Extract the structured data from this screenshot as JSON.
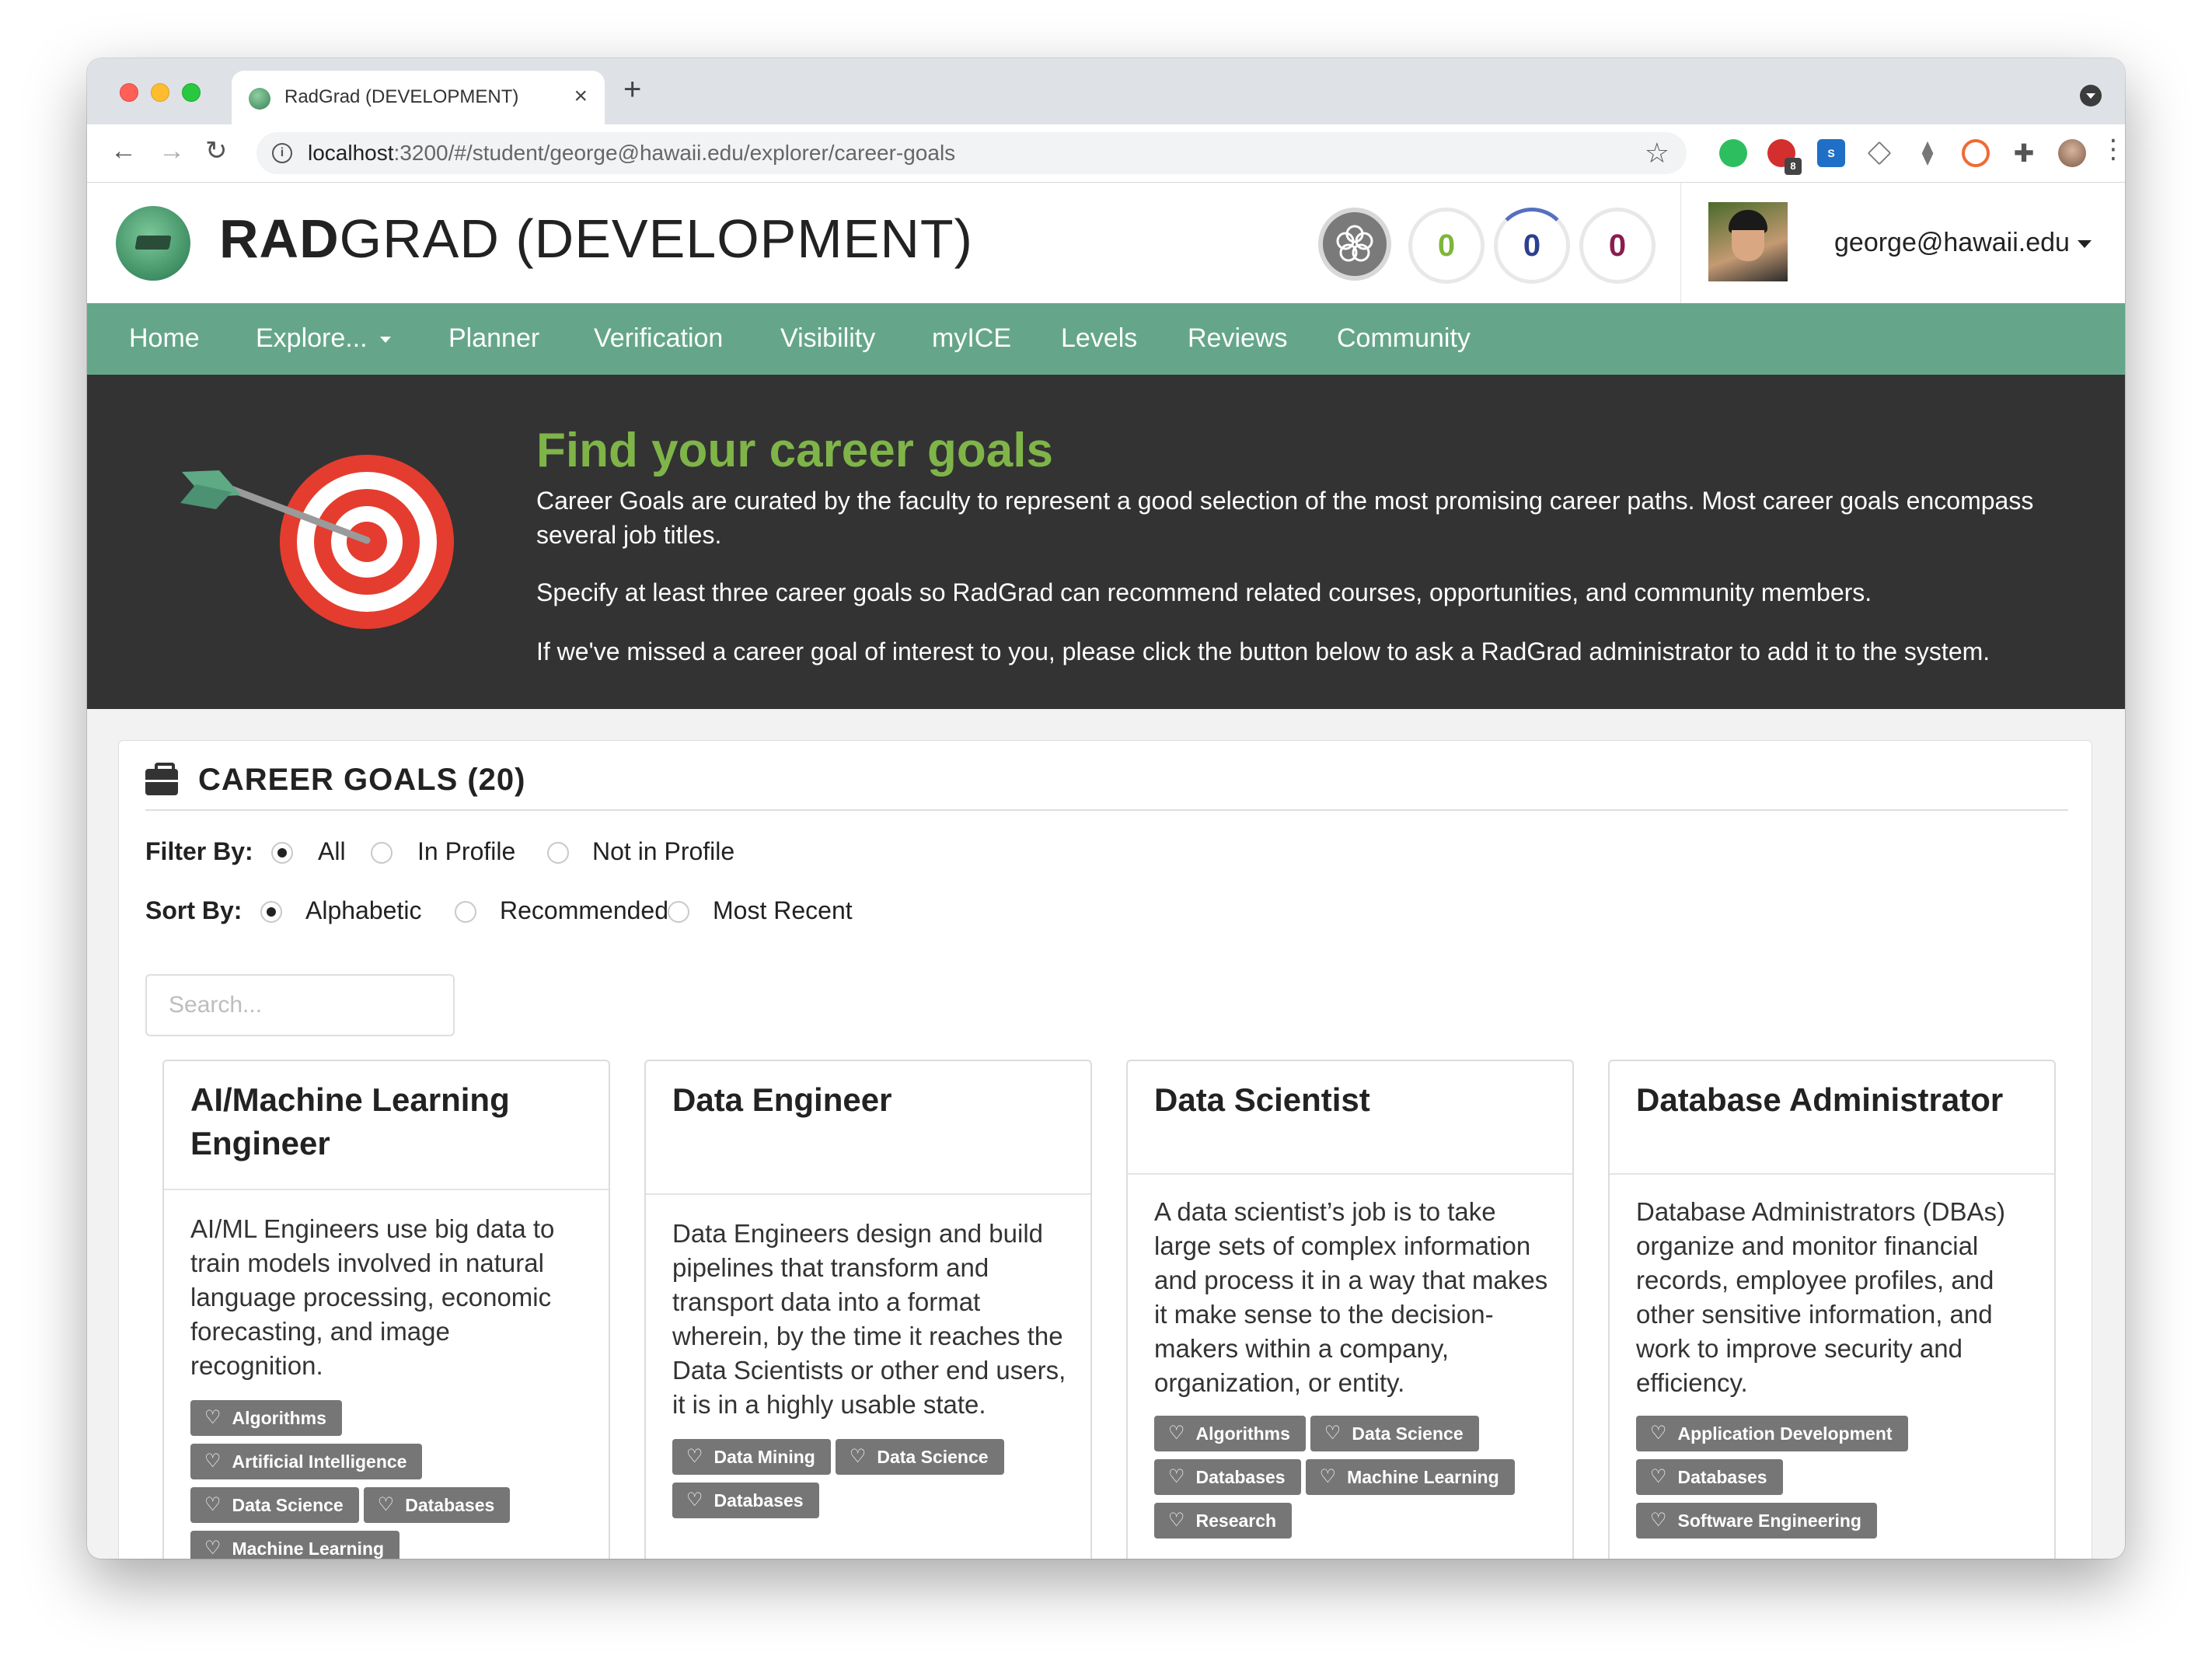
{
  "browser": {
    "tab_title": "RadGrad (DEVELOPMENT)",
    "tab_close": "×",
    "new_tab": "+",
    "url_host": "localhost",
    "url_rest": ":3200/#/student/george@hawaii.edu/explorer/career-goals",
    "extension_badge": "8"
  },
  "header": {
    "title_bold": "RAD",
    "title_rest": "GRAD (DEVELOPMENT)",
    "scores": [
      "0",
      "0",
      "0"
    ],
    "user_email": "george@hawaii.edu"
  },
  "nav": {
    "items": [
      "Home",
      "Explore...",
      "Planner",
      "Verification",
      "Visibility",
      "myICE",
      "Levels",
      "Reviews",
      "Community"
    ]
  },
  "banner": {
    "title": "Find your career goals",
    "paragraphs": [
      "Career Goals are curated by the faculty to represent a good selection of the most promising career paths. Most career goals encompass several job titles.",
      "Specify at least three career goals so RadGrad can recommend related courses, opportunities, and community members.",
      "If we've missed a career goal of interest to you, please click the button below to ask a RadGrad administrator to add it to the system."
    ]
  },
  "panel": {
    "title": "CAREER GOALS (20)",
    "filter": {
      "label": "Filter By:",
      "options": [
        "All",
        "In Profile",
        "Not in Profile"
      ],
      "selected": "All"
    },
    "sort": {
      "label": "Sort By:",
      "options": [
        "Alphabetic",
        "Recommended",
        "Most Recent"
      ],
      "selected": "Alphabetic"
    },
    "search_placeholder": "Search..."
  },
  "cards": [
    {
      "title": "AI/Machine Learning Engineer",
      "description": "AI/ML Engineers use big data to train models involved in natural language processing, economic forecasting, and image recognition.",
      "tags": [
        "Algorithms",
        "Artificial Intelligence",
        "Data Science",
        "Databases",
        "Machine Learning"
      ]
    },
    {
      "title": "Data Engineer",
      "description": "Data Engineers design and build pipelines that transform and transport data into a format wherein, by the time it reaches the Data Scientists or other end users, it is in a highly usable state.",
      "tags": [
        "Data Mining",
        "Data Science",
        "Databases"
      ]
    },
    {
      "title": "Data Scientist",
      "description": "A data scientist’s job is to take large sets of complex information and process it in a way that makes it make sense to the decision-makers within a company, organization, or entity.",
      "tags": [
        "Algorithms",
        "Data Science",
        "Databases",
        "Machine Learning",
        "Research"
      ]
    },
    {
      "title": "Database Administrator",
      "description": "Database Administrators (DBAs) organize and monitor financial records, employee profiles, and other sensitive information, and work to improve security and efficiency.",
      "tags": [
        "Application Development",
        "Databases",
        "Software Engineering"
      ]
    }
  ],
  "colors": {
    "nav_green": "#65a68a",
    "banner_title_green": "#7fb548",
    "banner_bg": "#333333",
    "tag_gray": "#767676"
  }
}
